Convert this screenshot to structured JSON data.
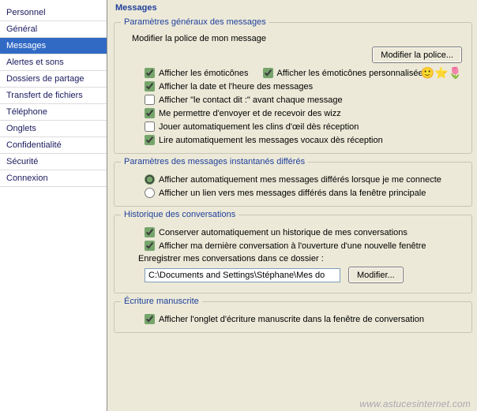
{
  "sidebar": {
    "selectedIndex": 2,
    "items": [
      "Personnel",
      "Général",
      "Messages",
      "Alertes et sons",
      "Dossiers de partage",
      "Transfert de fichiers",
      "Téléphone",
      "Onglets",
      "Confidentialité",
      "Sécurité",
      "Connexion"
    ]
  },
  "page": {
    "title": "Messages"
  },
  "general": {
    "legend": "Paramètres généraux des messages",
    "fontLabel": "Modifier la police de mon message",
    "fontButton": "Modifier la police...",
    "showEmoticons": {
      "label": "Afficher les émoticônes",
      "checked": true
    },
    "showCustomEmoticons": {
      "label": "Afficher les émoticônes personnalisées",
      "checked": true
    },
    "emojiDecor": "🙂⭐🌷",
    "showDateTime": {
      "label": "Afficher la date et l'heure des messages",
      "checked": true
    },
    "showContactSays": {
      "label": "Afficher \"le contact dit :\" avant chaque message",
      "checked": false
    },
    "allowWizz": {
      "label": "Me permettre d'envoyer et de recevoir des wizz",
      "checked": true
    },
    "autoPlayWinks": {
      "label": "Jouer automatiquement les clins d'œil dès réception",
      "checked": false
    },
    "autoReadVoice": {
      "label": "Lire automatiquement les messages vocaux dès réception",
      "checked": true
    }
  },
  "offline": {
    "legend": "Paramètres des messages instantanés différés",
    "radioSelected": 0,
    "optionAuto": "Afficher automatiquement mes messages différés lorsque je me connecte",
    "optionLink": "Afficher un lien vers mes messages différés dans la fenêtre principale"
  },
  "history": {
    "legend": "Historique des conversations",
    "keepHistory": {
      "label": "Conserver automatiquement un historique de mes conversations",
      "checked": true
    },
    "showLast": {
      "label": "Afficher ma dernière conversation à l'ouverture d'une nouvelle fenêtre",
      "checked": true
    },
    "folderLabel": "Enregistrer mes conversations dans ce dossier :",
    "folderPath": "C:\\Documents and Settings\\Stéphane\\Mes do",
    "changeButton": "Modifier..."
  },
  "handwriting": {
    "legend": "Écriture manuscrite",
    "showTab": {
      "label": "Afficher l'onglet d'écriture manuscrite dans la fenêtre de conversation",
      "checked": true
    }
  },
  "footerUrl": "www.astucesinternet.com"
}
